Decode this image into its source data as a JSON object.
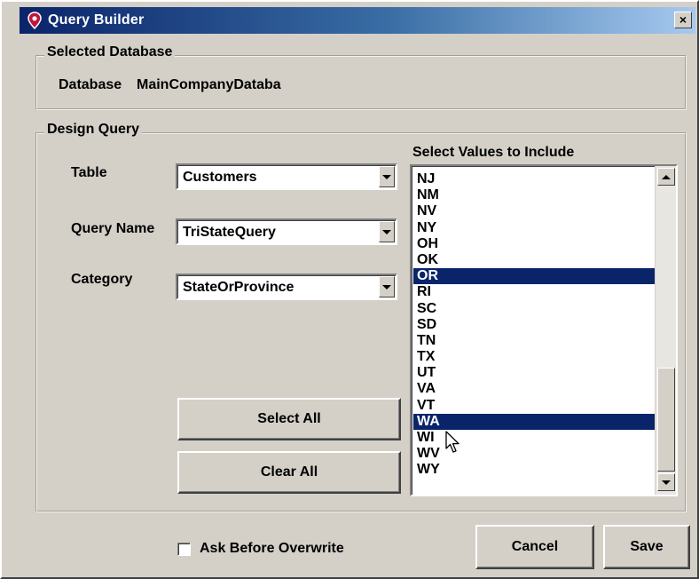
{
  "window": {
    "title": "Query Builder",
    "close_glyph": "×",
    "title_gradient": [
      "#0a246a",
      "#a6caf0"
    ],
    "face_color": "#d4d0c8"
  },
  "selected_database": {
    "legend": "Selected Database",
    "label": "Database",
    "value": "MainCompanyDataba"
  },
  "design_query": {
    "legend": "Design Query",
    "table_label": "Table",
    "table_value": "Customers",
    "query_name_label": "Query Name",
    "query_name_value": "TriStateQuery",
    "category_label": "Category",
    "category_value": "StateOrProvince",
    "values_label": "Select Values to Include",
    "values": [
      "NJ",
      "NM",
      "NV",
      "NY",
      "OH",
      "OK",
      "OR",
      "RI",
      "SC",
      "SD",
      "TN",
      "TX",
      "UT",
      "VA",
      "VT",
      "WA",
      "WI",
      "WV",
      "WY"
    ],
    "selected_values": [
      "OR",
      "WA"
    ],
    "selection_color": "#0a246a",
    "select_all_label": "Select All",
    "clear_all_label": "Clear All"
  },
  "footer": {
    "ask_overwrite_label": "Ask Before Overwrite",
    "ask_overwrite_checked": false,
    "cancel_label": "Cancel",
    "save_label": "Save"
  },
  "icons": {
    "app": "map-pin-icon",
    "close": "close-icon",
    "dropdown": "chevron-down-icon",
    "scroll_up": "arrow-up-icon",
    "scroll_down": "arrow-down-icon",
    "cursor": "mouse-pointer-icon"
  }
}
